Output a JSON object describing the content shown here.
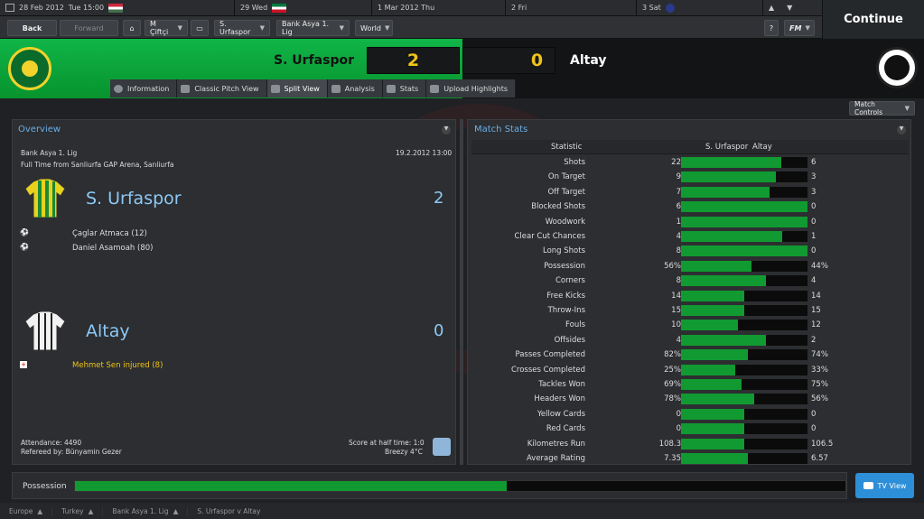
{
  "datebar": {
    "current_date": "28 Feb 2012",
    "current_time": "Tue 15:00",
    "next1": "29 Wed",
    "next2": "1 Mar 2012 Thu",
    "next3": "2 Fri",
    "next4": "3 Sat"
  },
  "nav": {
    "back": "Back",
    "forward": "Forward",
    "manager": "M Çiftçi",
    "team": "S. Urfaspor",
    "league": "Bank Asya 1. Lig",
    "world": "World",
    "help": "?",
    "fm": "FM",
    "continue": "Continue"
  },
  "match": {
    "home_team": "S. Urfaspor",
    "away_team": "Altay",
    "home_score": "2",
    "away_score": "0"
  },
  "tabs": [
    "Information",
    "Classic Pitch View",
    "Split View",
    "Analysis",
    "Stats",
    "Upload Highlights"
  ],
  "match_controls": "Match Controls",
  "overview": {
    "title": "Overview",
    "competition": "Bank Asya 1. Lig",
    "datetime": "19.2.2012 13:00",
    "result_line": "Full Time from Sanliurfa GAP Arena, Sanliurfa",
    "home_name": "S. Urfaspor",
    "home_goals": "2",
    "home_events": [
      "Çaglar Atmaca (12)",
      "Daniel Asamoah (80)"
    ],
    "away_name": "Altay",
    "away_goals": "0",
    "away_events": [
      "Mehmet Sen injured (8)"
    ],
    "attendance": "Attendance: 4490",
    "referee": "Refereed by: Bünyamin Gezer",
    "halftime": "Score at half time: 1:0",
    "weather": "Breezy 4°C"
  },
  "stats": {
    "title": "Match Stats",
    "col_statistic": "Statistic",
    "col_home": "S. Urfaspor",
    "col_away": "Altay",
    "rows": [
      {
        "label": "Shots",
        "home": "22",
        "away": "6",
        "share": 0.79
      },
      {
        "label": "On Target",
        "home": "9",
        "away": "3",
        "share": 0.75
      },
      {
        "label": "Off Target",
        "home": "7",
        "away": "3",
        "share": 0.7
      },
      {
        "label": "Blocked Shots",
        "home": "6",
        "away": "0",
        "share": 1.0
      },
      {
        "label": "Woodwork",
        "home": "1",
        "away": "0",
        "share": 1.0
      },
      {
        "label": "Clear Cut Chances",
        "home": "4",
        "away": "1",
        "share": 0.8
      },
      {
        "label": "Long Shots",
        "home": "8",
        "away": "0",
        "share": 1.0
      },
      {
        "label": "Possession",
        "home": "56%",
        "away": "44%",
        "share": 0.56
      },
      {
        "label": "Corners",
        "home": "8",
        "away": "4",
        "share": 0.67
      },
      {
        "label": "Free Kicks",
        "home": "14",
        "away": "14",
        "share": 0.5
      },
      {
        "label": "Throw-Ins",
        "home": "15",
        "away": "15",
        "share": 0.5
      },
      {
        "label": "Fouls",
        "home": "10",
        "away": "12",
        "share": 0.45
      },
      {
        "label": "Offsides",
        "home": "4",
        "away": "2",
        "share": 0.67
      },
      {
        "label": "Passes Completed",
        "home": "82%",
        "away": "74%",
        "share": 0.53
      },
      {
        "label": "Crosses Completed",
        "home": "25%",
        "away": "33%",
        "share": 0.43
      },
      {
        "label": "Tackles Won",
        "home": "69%",
        "away": "75%",
        "share": 0.48
      },
      {
        "label": "Headers Won",
        "home": "78%",
        "away": "56%",
        "share": 0.58
      },
      {
        "label": "Yellow Cards",
        "home": "0",
        "away": "0",
        "share": 0.5
      },
      {
        "label": "Red Cards",
        "home": "0",
        "away": "0",
        "share": 0.5
      },
      {
        "label": "Kilometres Run",
        "home": "108.3",
        "away": "106.5",
        "share": 0.5
      },
      {
        "label": "Average Rating",
        "home": "7.35",
        "away": "6.57",
        "share": 0.53
      }
    ]
  },
  "possession_bar": {
    "label": "Possession",
    "home_share": 0.56
  },
  "tv_view": "TV View",
  "footer": [
    "Europe",
    "Turkey",
    "Bank Asya 1. Lig",
    "S. Urfaspor v Altay"
  ],
  "colors": {
    "home_green": "#119a31",
    "score_yellow": "#f0c419",
    "link_blue": "#6aaee8"
  }
}
